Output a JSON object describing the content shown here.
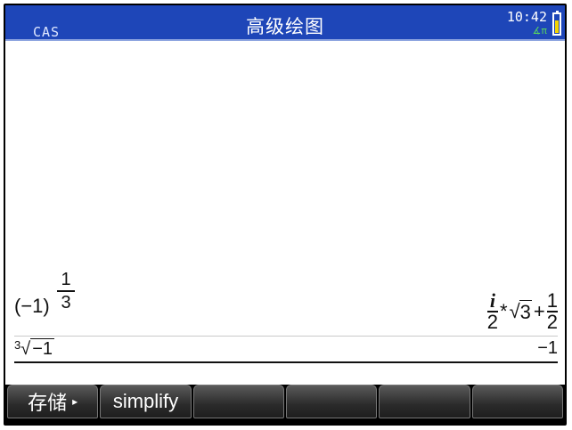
{
  "status": {
    "mode": "CAS",
    "title": "高级绘图",
    "time": "10:42",
    "angle_indicator": "∡π"
  },
  "history": [
    {
      "input": {
        "base": "(−1)",
        "exp_num": "1",
        "exp_den": "3"
      },
      "result": {
        "i": "i",
        "two_a": "2",
        "times": "*",
        "radicand": "3",
        "plus": "+",
        "one": "1",
        "two_b": "2"
      }
    },
    {
      "input": {
        "index": "3",
        "radicand": "−1"
      },
      "result": "−1"
    }
  ],
  "softkeys": [
    {
      "label": "存储",
      "arrow": "▸"
    },
    {
      "label": "simplify"
    },
    {
      "label": ""
    },
    {
      "label": ""
    },
    {
      "label": ""
    },
    {
      "label": ""
    }
  ]
}
